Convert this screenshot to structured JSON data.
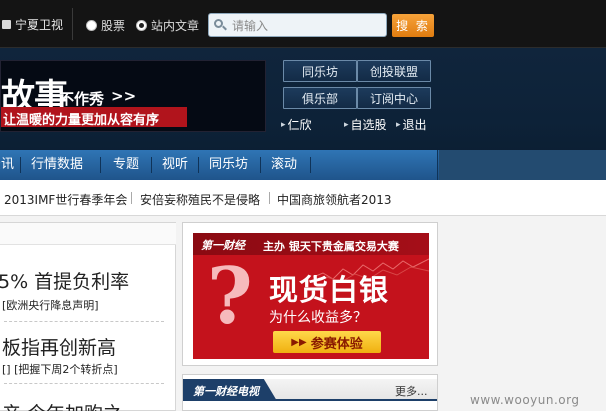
{
  "topbar": {
    "channel_label": "宁夏卫视",
    "radio_stocks": "股票",
    "radio_articles": "站内文章",
    "search_placeholder": "请输入",
    "search_button": "搜 索"
  },
  "banner": {
    "big_text": "故事",
    "medium_text": "不作秀",
    "chevron": ">>",
    "strip_text": "让温暖的力量更加从容有序"
  },
  "header_buttons": [
    "同乐坊",
    "创投联盟",
    "俱乐部",
    "订阅中心"
  ],
  "user_links": [
    "仁欣",
    "自选股",
    "退出"
  ],
  "nav": {
    "items": [
      "资讯",
      "行情数据",
      "专题",
      "视听",
      "同乐坊",
      "滚动"
    ]
  },
  "ticker": [
    "2013IMF世行春季年会",
    "安倍妄称殖民不是侵略",
    "中国商旅领航者2013"
  ],
  "news": [
    {
      "title": "5% 首提负利率",
      "links": "[欧洲央行降息声明]"
    },
    {
      "title": "板指再创新高",
      "links": "[] [把握下周2个转折点]"
    },
    {
      "title": "产 今年加购之",
      "links": ""
    }
  ],
  "ad": {
    "logo": "第一财经",
    "headline": "主办 银天下贵金属交易大赛",
    "question_mark": "?",
    "main": "现货白银",
    "sub": "为什么收益多？",
    "cta": "参赛体验"
  },
  "tv": {
    "title": "第一财经电视",
    "more": "更多..."
  },
  "watermark": "www.wooyun.org"
}
